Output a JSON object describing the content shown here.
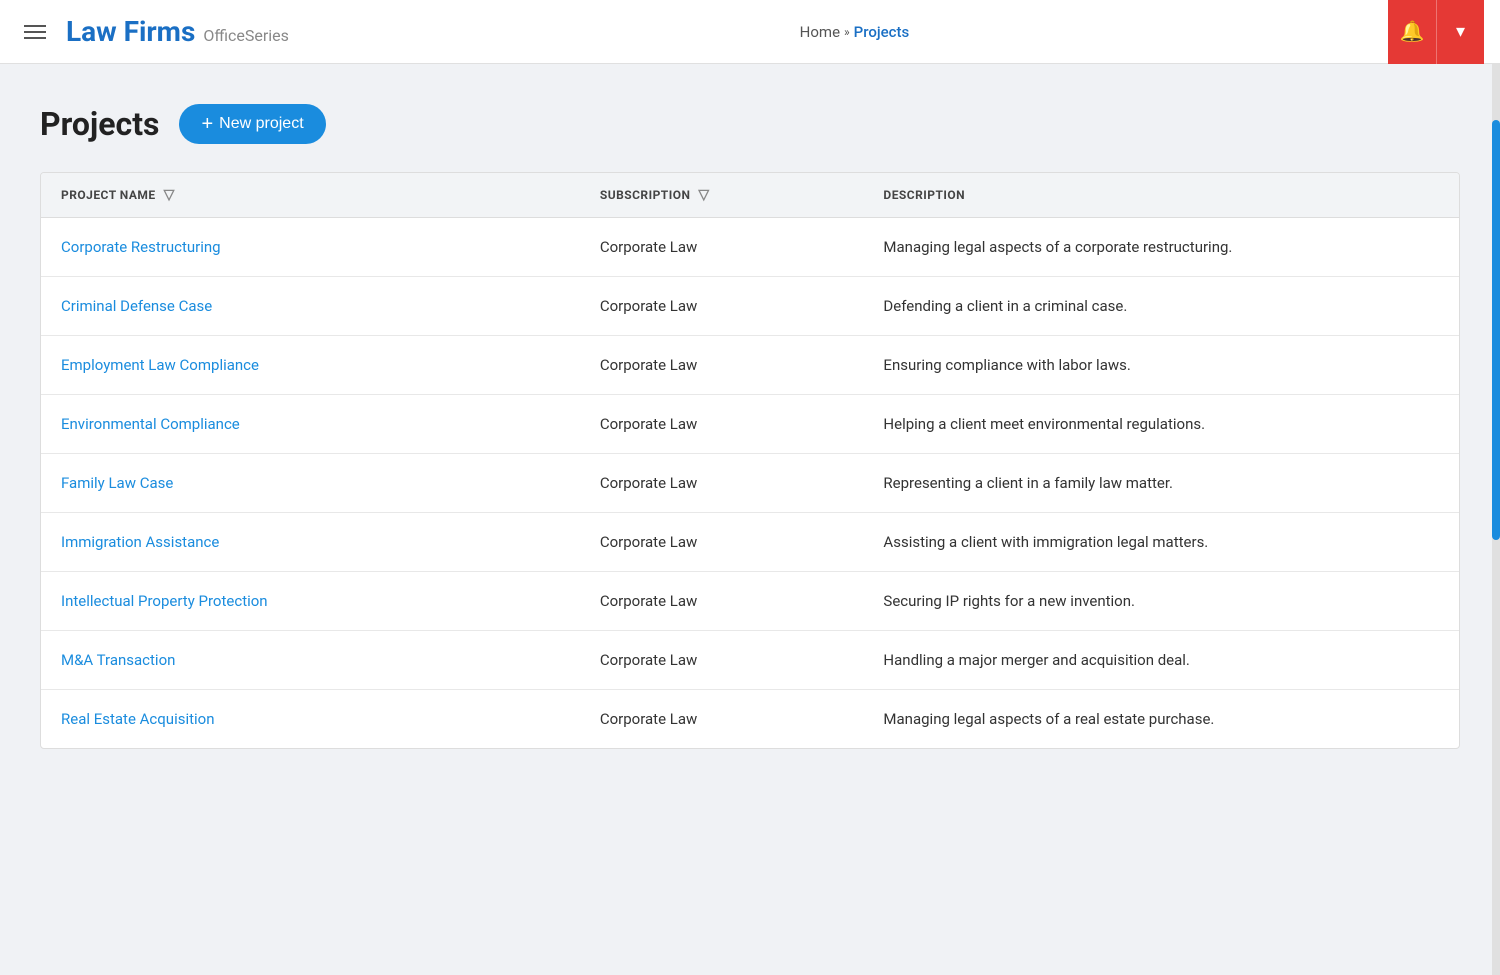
{
  "header": {
    "menu_label": "Menu",
    "logo_title": "Law Firms",
    "logo_sub": "OfficeSeries",
    "breadcrumb": {
      "home": "Home",
      "separator": "»",
      "current": "Projects"
    },
    "bell_icon": "🔔",
    "dropdown_icon": "▾"
  },
  "page": {
    "title": "Projects",
    "new_project_button": "+ New project"
  },
  "table": {
    "columns": [
      {
        "key": "name",
        "label": "PROJECT NAME",
        "filterable": true
      },
      {
        "key": "subscription",
        "label": "SUBSCRIPTION",
        "filterable": true
      },
      {
        "key": "description",
        "label": "DESCRIPTION",
        "filterable": false
      }
    ],
    "rows": [
      {
        "name": "Corporate Restructuring",
        "subscription": "Corporate Law",
        "description": "Managing legal aspects of a corporate restructuring."
      },
      {
        "name": "Criminal Defense Case",
        "subscription": "Corporate Law",
        "description": "Defending a client in a criminal case."
      },
      {
        "name": "Employment Law Compliance",
        "subscription": "Corporate Law",
        "description": "Ensuring compliance with labor laws."
      },
      {
        "name": "Environmental Compliance",
        "subscription": "Corporate Law",
        "description": "Helping a client meet environmental regulations."
      },
      {
        "name": "Family Law Case",
        "subscription": "Corporate Law",
        "description": "Representing a client in a family law matter."
      },
      {
        "name": "Immigration Assistance",
        "subscription": "Corporate Law",
        "description": "Assisting a client with immigration legal matters."
      },
      {
        "name": "Intellectual Property Protection",
        "subscription": "Corporate Law",
        "description": "Securing IP rights for a new invention."
      },
      {
        "name": "M&A Transaction",
        "subscription": "Corporate Law",
        "description": "Handling a major merger and acquisition deal."
      },
      {
        "name": "Real Estate Acquisition",
        "subscription": "Corporate Law",
        "description": "Managing legal aspects of a real estate purchase."
      }
    ]
  }
}
